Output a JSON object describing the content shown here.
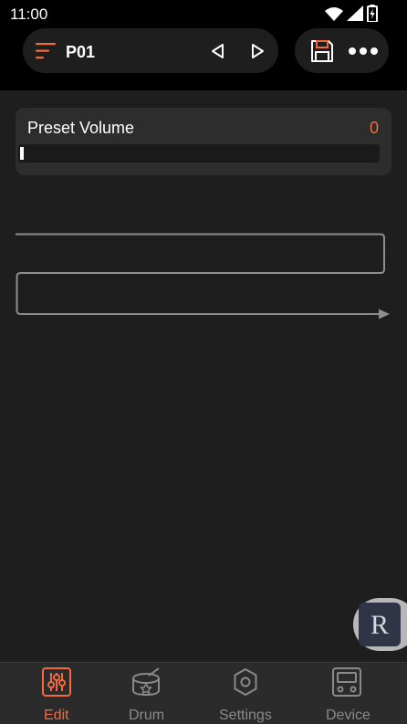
{
  "status_bar": {
    "time": "11:00"
  },
  "header": {
    "preset_name": "P01",
    "menu_icon": "menu-lines-icon",
    "prev_icon": "triangle-left-icon",
    "next_icon": "triangle-right-icon",
    "save_icon": "floppy-disk-icon",
    "more_icon": "more-dots-icon"
  },
  "preset_volume": {
    "label": "Preset Volume",
    "value": "0",
    "level": 0
  },
  "float_button": {
    "letter": "R"
  },
  "nav": {
    "items": [
      {
        "label": "Edit",
        "icon": "sliders-icon",
        "active": true
      },
      {
        "label": "Drum",
        "icon": "drum-icon",
        "active": false
      },
      {
        "label": "Settings",
        "icon": "gear-icon",
        "active": false
      },
      {
        "label": "Device",
        "icon": "device-icon",
        "active": false
      }
    ]
  },
  "colors": {
    "accent": "#f36a3d",
    "background": "#1f1e1e",
    "bar": "#000000",
    "card": "#2e2d2d",
    "nav_bg": "#2c2b2b",
    "inactive": "#8a8a8a"
  }
}
